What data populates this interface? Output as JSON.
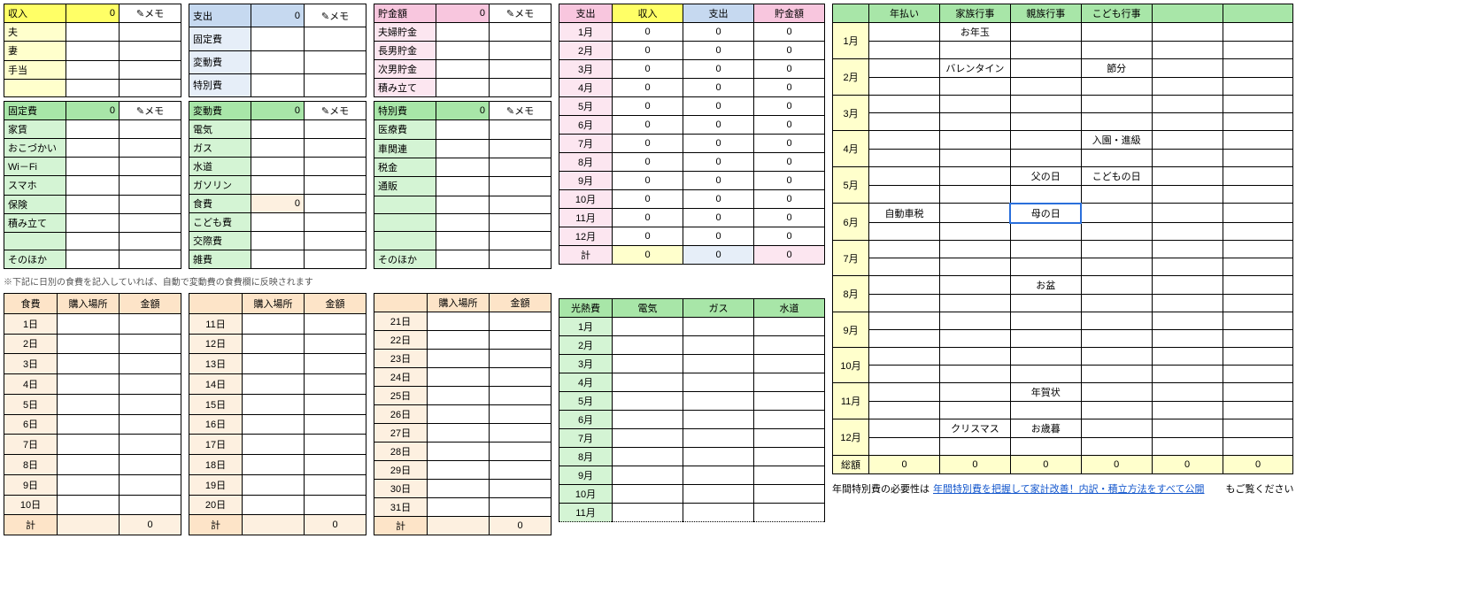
{
  "memo_label": "✎メモ",
  "income": {
    "title": "収入",
    "value": 0,
    "rows": [
      "夫",
      "妻",
      "手当",
      ""
    ]
  },
  "expense": {
    "title": "支出",
    "value": 0,
    "rows": [
      "固定費",
      "変動費",
      "特別費"
    ]
  },
  "savings": {
    "title": "貯金額",
    "value": 0,
    "rows": [
      "夫婦貯金",
      "長男貯金",
      "次男貯金",
      "積み立て"
    ]
  },
  "fixed": {
    "title": "固定費",
    "value": 0,
    "rows": [
      "家賃",
      "おこづかい",
      "Wi－Fi",
      "スマホ",
      "保険",
      "積み立て",
      "",
      "そのほか"
    ]
  },
  "variable": {
    "title": "変動費",
    "value": 0,
    "rows": [
      "電気",
      "ガス",
      "水道",
      "ガソリン",
      "食費",
      "こども費",
      "交際費",
      "雑費"
    ],
    "food_value": 0
  },
  "special": {
    "title": "特別費",
    "value": 0,
    "rows": [
      "医療費",
      "車関連",
      "税金",
      "通販",
      "",
      "",
      "",
      "そのほか"
    ]
  },
  "food_note": "※下記に日別の食費を記入していれば、自動で変動費の食費欄に反映されます",
  "food_table": {
    "headers": [
      "食費",
      "購入場所",
      "金額"
    ],
    "days1": [
      "1日",
      "2日",
      "3日",
      "4日",
      "5日",
      "6日",
      "7日",
      "8日",
      "9日",
      "10日"
    ],
    "days2": [
      "11日",
      "12日",
      "13日",
      "14日",
      "15日",
      "16日",
      "17日",
      "18日",
      "19日",
      "20日"
    ],
    "days3": [
      "21日",
      "22日",
      "23日",
      "24日",
      "25日",
      "26日",
      "27日",
      "28日",
      "29日",
      "30日",
      "31日"
    ],
    "total_label": "計",
    "total_value": 0
  },
  "monthly_summary": {
    "headers": [
      "支出",
      "収入",
      "支出",
      "貯金額"
    ],
    "months": [
      "1月",
      "2月",
      "3月",
      "4月",
      "5月",
      "6月",
      "7月",
      "8月",
      "9月",
      "10月",
      "11月",
      "12月"
    ],
    "total_label": "計",
    "zero": 0
  },
  "utilities": {
    "headers": [
      "光熱費",
      "電気",
      "ガス",
      "水道"
    ],
    "months": [
      "1月",
      "2月",
      "3月",
      "4月",
      "5月",
      "6月",
      "7月",
      "8月",
      "9月",
      "10月",
      "11月"
    ]
  },
  "events": {
    "headers": [
      "",
      "年払い",
      "家族行事",
      "親族行事",
      "こども行事",
      "",
      ""
    ],
    "months": [
      "1月",
      "2月",
      "3月",
      "4月",
      "5月",
      "6月",
      "7月",
      "8月",
      "9月",
      "10月",
      "11月",
      "12月"
    ],
    "cells": {
      "m1_family": "お年玉",
      "m2_family": "バレンタイン",
      "m2_child": "節分",
      "m4_child": "入園・進級",
      "m5_rel": "父の日",
      "m5_child": "こどもの日",
      "m6_annual": "自動車税",
      "m6_rel": "母の日",
      "m8_rel": "お盆",
      "m11_rel": "年賀状",
      "m12_family": "クリスマス",
      "m12_rel": "お歳暮"
    },
    "total_label": "総額",
    "total_value": 0
  },
  "footer": {
    "prefix": "年間特別費の必要性は",
    "link": "年間特別費を把握して家計改善！内訳・積立方法をすべて公開",
    "suffix": "もご覧ください"
  }
}
